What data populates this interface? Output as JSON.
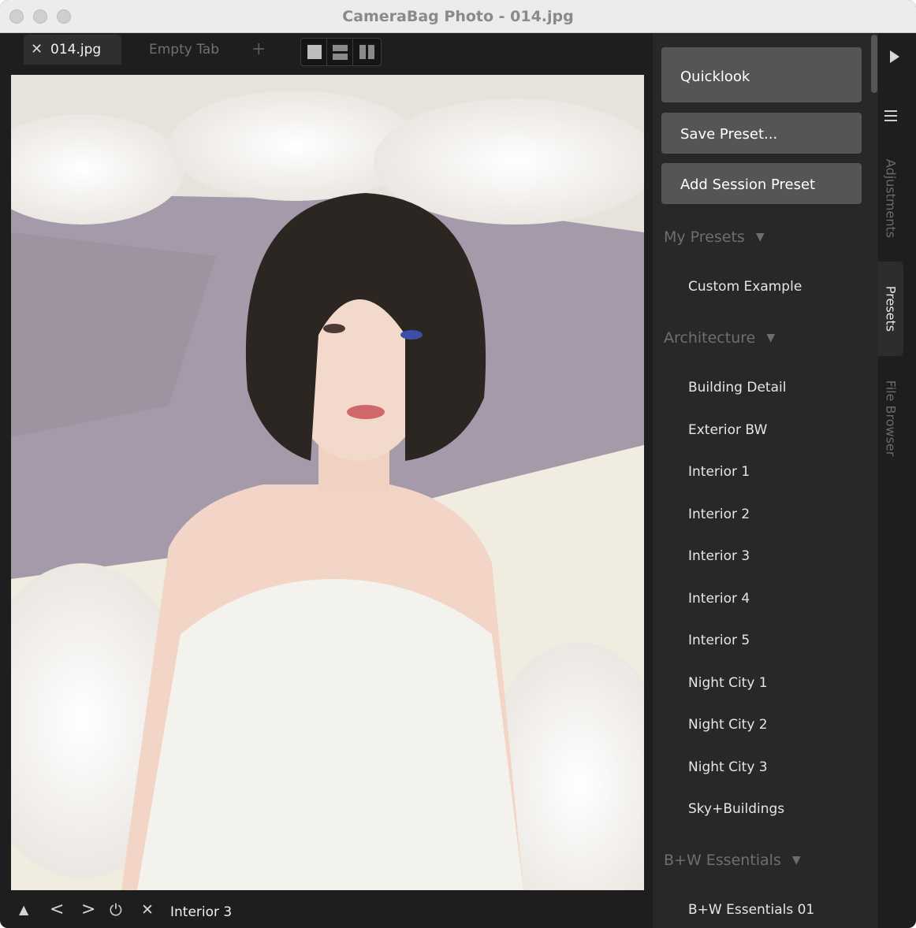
{
  "window": {
    "title": "CameraBag Photo - 014.jpg"
  },
  "tabs": [
    {
      "label": "014.jpg",
      "close": "✕"
    },
    {
      "label": "Empty Tab"
    }
  ],
  "add_tab_symbol": "+",
  "actions": {
    "quicklook": "Quicklook",
    "save_preset": "Save Preset...",
    "add_session_preset": "Add Session Preset"
  },
  "sections": [
    {
      "title": "My Presets",
      "items": [
        "Custom Example"
      ]
    },
    {
      "title": "Architecture",
      "items": [
        "Building Detail",
        "Exterior BW",
        "Interior 1",
        "Interior 2",
        "Interior 3",
        "Interior 4",
        "Interior 5",
        "Night City 1",
        "Night City 2",
        "Night City 3",
        "Sky+Buildings"
      ]
    },
    {
      "title": "B+W Essentials",
      "items": [
        "B+W Essentials 01"
      ]
    }
  ],
  "side_tabs": {
    "adjustments": "Adjustments",
    "presets": "Presets",
    "file_browser": "File Browser"
  },
  "status": {
    "current_preset": "Interior 3"
  },
  "bottom_icons": {
    "up": "▲",
    "prev": "<",
    "next": ">",
    "power": "⏻",
    "close": "✕"
  },
  "colors": {
    "panel_bg": "#282828",
    "button_bg": "#555555",
    "window_bg": "#1e1e1e"
  }
}
